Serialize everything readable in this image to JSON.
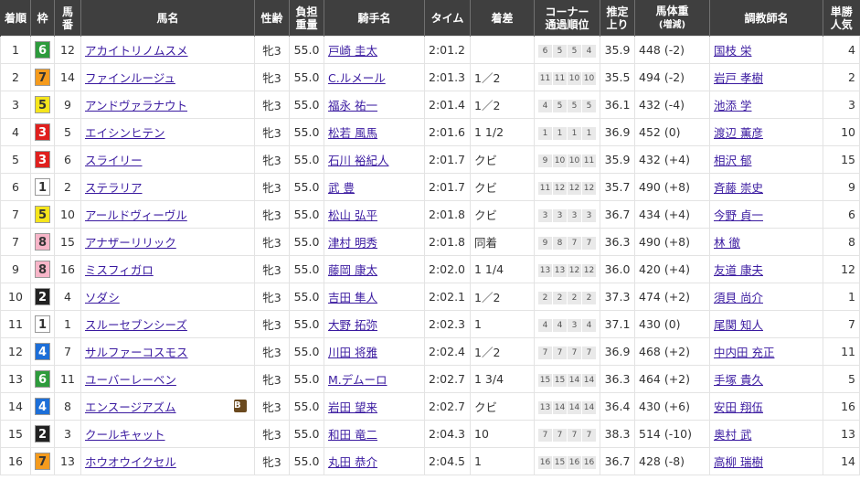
{
  "headers": {
    "rank": "着順",
    "waku": "枠",
    "num": [
      "馬",
      "番"
    ],
    "horse": "馬名",
    "sexage": "性齢",
    "weight": [
      "負担",
      "重量"
    ],
    "jockey": "騎手名",
    "time": "タイム",
    "margin": "着差",
    "corner": [
      "コーナー",
      "通過順位"
    ],
    "last3f": [
      "推定",
      "上り"
    ],
    "bodyweight": [
      "馬体重",
      "(増減)"
    ],
    "trainer": "調教師名",
    "pop": [
      "単勝",
      "人気"
    ]
  },
  "waku_colors": {
    "1": {
      "bg": "#ffffff",
      "fg": "#333333"
    },
    "2": {
      "bg": "#222222",
      "fg": "#ffffff"
    },
    "3": {
      "bg": "#e0201e",
      "fg": "#ffffff"
    },
    "4": {
      "bg": "#1d6fd8",
      "fg": "#ffffff"
    },
    "5": {
      "bg": "#f5e51c",
      "fg": "#333333"
    },
    "6": {
      "bg": "#2d9b3c",
      "fg": "#ffffff"
    },
    "7": {
      "bg": "#f59b1d",
      "fg": "#333333"
    },
    "8": {
      "bg": "#f7b5c8",
      "fg": "#333333"
    }
  },
  "rows": [
    {
      "rank": "1",
      "waku": "6",
      "num": "12",
      "horse": "アカイトリノムスメ",
      "sexage": "牝3",
      "weight": "55.0",
      "jockey": "戸崎 圭太",
      "time": "2:01.2",
      "margin": "",
      "corner": [
        "6",
        "5",
        "5",
        "4"
      ],
      "last3f": "35.9",
      "bodyweight": "448 (-2)",
      "trainer": "国枝 栄",
      "pop": "4",
      "blink": ""
    },
    {
      "rank": "2",
      "waku": "7",
      "num": "14",
      "horse": "ファインルージュ",
      "sexage": "牝3",
      "weight": "55.0",
      "jockey": "C.ルメール",
      "time": "2:01.3",
      "margin": "1／2",
      "corner": [
        "11",
        "11",
        "10",
        "10"
      ],
      "last3f": "35.5",
      "bodyweight": "494 (-2)",
      "trainer": "岩戸 孝樹",
      "pop": "2",
      "blink": ""
    },
    {
      "rank": "3",
      "waku": "5",
      "num": "9",
      "horse": "アンドヴァラナウト",
      "sexage": "牝3",
      "weight": "55.0",
      "jockey": "福永 祐一",
      "time": "2:01.4",
      "margin": "1／2",
      "corner": [
        "4",
        "5",
        "5",
        "5"
      ],
      "last3f": "36.1",
      "bodyweight": "432 (-4)",
      "trainer": "池添 学",
      "pop": "3",
      "blink": ""
    },
    {
      "rank": "4",
      "waku": "3",
      "num": "5",
      "horse": "エイシンヒテン",
      "sexage": "牝3",
      "weight": "55.0",
      "jockey": "松若 風馬",
      "time": "2:01.6",
      "margin": "1 1/2",
      "corner": [
        "1",
        "1",
        "1",
        "1"
      ],
      "last3f": "36.9",
      "bodyweight": "452 (0)",
      "trainer": "渡辺 薫彦",
      "pop": "10",
      "blink": ""
    },
    {
      "rank": "5",
      "waku": "3",
      "num": "6",
      "horse": "スライリー",
      "sexage": "牝3",
      "weight": "55.0",
      "jockey": "石川 裕紀人",
      "time": "2:01.7",
      "margin": "クビ",
      "corner": [
        "9",
        "10",
        "10",
        "11"
      ],
      "last3f": "35.9",
      "bodyweight": "432 (+4)",
      "trainer": "相沢 郁",
      "pop": "15",
      "blink": ""
    },
    {
      "rank": "6",
      "waku": "1",
      "num": "2",
      "horse": "ステラリア",
      "sexage": "牝3",
      "weight": "55.0",
      "jockey": "武 豊",
      "time": "2:01.7",
      "margin": "クビ",
      "corner": [
        "11",
        "12",
        "12",
        "12"
      ],
      "last3f": "35.7",
      "bodyweight": "490 (+8)",
      "trainer": "斉藤 崇史",
      "pop": "9",
      "blink": ""
    },
    {
      "rank": "7",
      "waku": "5",
      "num": "10",
      "horse": "アールドヴィーヴル",
      "sexage": "牝3",
      "weight": "55.0",
      "jockey": "松山 弘平",
      "time": "2:01.8",
      "margin": "クビ",
      "corner": [
        "3",
        "3",
        "3",
        "3"
      ],
      "last3f": "36.7",
      "bodyweight": "434 (+4)",
      "trainer": "今野 貞一",
      "pop": "6",
      "blink": ""
    },
    {
      "rank": "7",
      "waku": "8",
      "num": "15",
      "horse": "アナザーリリック",
      "sexage": "牝3",
      "weight": "55.0",
      "jockey": "津村 明秀",
      "time": "2:01.8",
      "margin": "同着",
      "corner": [
        "9",
        "8",
        "7",
        "7"
      ],
      "last3f": "36.3",
      "bodyweight": "490 (+8)",
      "trainer": "林 徹",
      "pop": "8",
      "blink": ""
    },
    {
      "rank": "9",
      "waku": "8",
      "num": "16",
      "horse": "ミスフィガロ",
      "sexage": "牝3",
      "weight": "55.0",
      "jockey": "藤岡 康太",
      "time": "2:02.0",
      "margin": "1 1/4",
      "corner": [
        "13",
        "13",
        "12",
        "12"
      ],
      "last3f": "36.0",
      "bodyweight": "420 (+4)",
      "trainer": "友道 康夫",
      "pop": "12",
      "blink": ""
    },
    {
      "rank": "10",
      "waku": "2",
      "num": "4",
      "horse": "ソダシ",
      "sexage": "牝3",
      "weight": "55.0",
      "jockey": "吉田 隼人",
      "time": "2:02.1",
      "margin": "1／2",
      "corner": [
        "2",
        "2",
        "2",
        "2"
      ],
      "last3f": "37.3",
      "bodyweight": "474 (+2)",
      "trainer": "須貝 尚介",
      "pop": "1",
      "blink": ""
    },
    {
      "rank": "11",
      "waku": "1",
      "num": "1",
      "horse": "スルーセブンシーズ",
      "sexage": "牝3",
      "weight": "55.0",
      "jockey": "大野 拓弥",
      "time": "2:02.3",
      "margin": "1",
      "corner": [
        "4",
        "4",
        "3",
        "4"
      ],
      "last3f": "37.1",
      "bodyweight": "430 (0)",
      "trainer": "尾関 知人",
      "pop": "7",
      "blink": ""
    },
    {
      "rank": "12",
      "waku": "4",
      "num": "7",
      "horse": "サルファーコスモス",
      "sexage": "牝3",
      "weight": "55.0",
      "jockey": "川田 将雅",
      "time": "2:02.4",
      "margin": "1／2",
      "corner": [
        "7",
        "7",
        "7",
        "7"
      ],
      "last3f": "36.9",
      "bodyweight": "468 (+2)",
      "trainer": "中内田 充正",
      "pop": "11",
      "blink": ""
    },
    {
      "rank": "13",
      "waku": "6",
      "num": "11",
      "horse": "ユーバーレーベン",
      "sexage": "牝3",
      "weight": "55.0",
      "jockey": "M.デムーロ",
      "time": "2:02.7",
      "margin": "1 3/4",
      "corner": [
        "15",
        "15",
        "14",
        "14"
      ],
      "last3f": "36.3",
      "bodyweight": "464 (+2)",
      "trainer": "手塚 貴久",
      "pop": "5",
      "blink": ""
    },
    {
      "rank": "14",
      "waku": "4",
      "num": "8",
      "horse": "エンスージアズム",
      "sexage": "牝3",
      "weight": "55.0",
      "jockey": "岩田 望来",
      "time": "2:02.7",
      "margin": "クビ",
      "corner": [
        "13",
        "14",
        "14",
        "14"
      ],
      "last3f": "36.4",
      "bodyweight": "430 (+6)",
      "trainer": "安田 翔伍",
      "pop": "16",
      "blink": "B"
    },
    {
      "rank": "15",
      "waku": "2",
      "num": "3",
      "horse": "クールキャット",
      "sexage": "牝3",
      "weight": "55.0",
      "jockey": "和田 竜二",
      "time": "2:04.3",
      "margin": "10",
      "corner": [
        "7",
        "7",
        "7",
        "7"
      ],
      "last3f": "38.3",
      "bodyweight": "514 (-10)",
      "trainer": "奥村 武",
      "pop": "13",
      "blink": ""
    },
    {
      "rank": "16",
      "waku": "7",
      "num": "13",
      "horse": "ホウオウイクセル",
      "sexage": "牝3",
      "weight": "55.0",
      "jockey": "丸田 恭介",
      "time": "2:04.5",
      "margin": "1",
      "corner": [
        "16",
        "15",
        "16",
        "16"
      ],
      "last3f": "36.7",
      "bodyweight": "428 (-8)",
      "trainer": "高柳 瑞樹",
      "pop": "14",
      "blink": ""
    }
  ]
}
